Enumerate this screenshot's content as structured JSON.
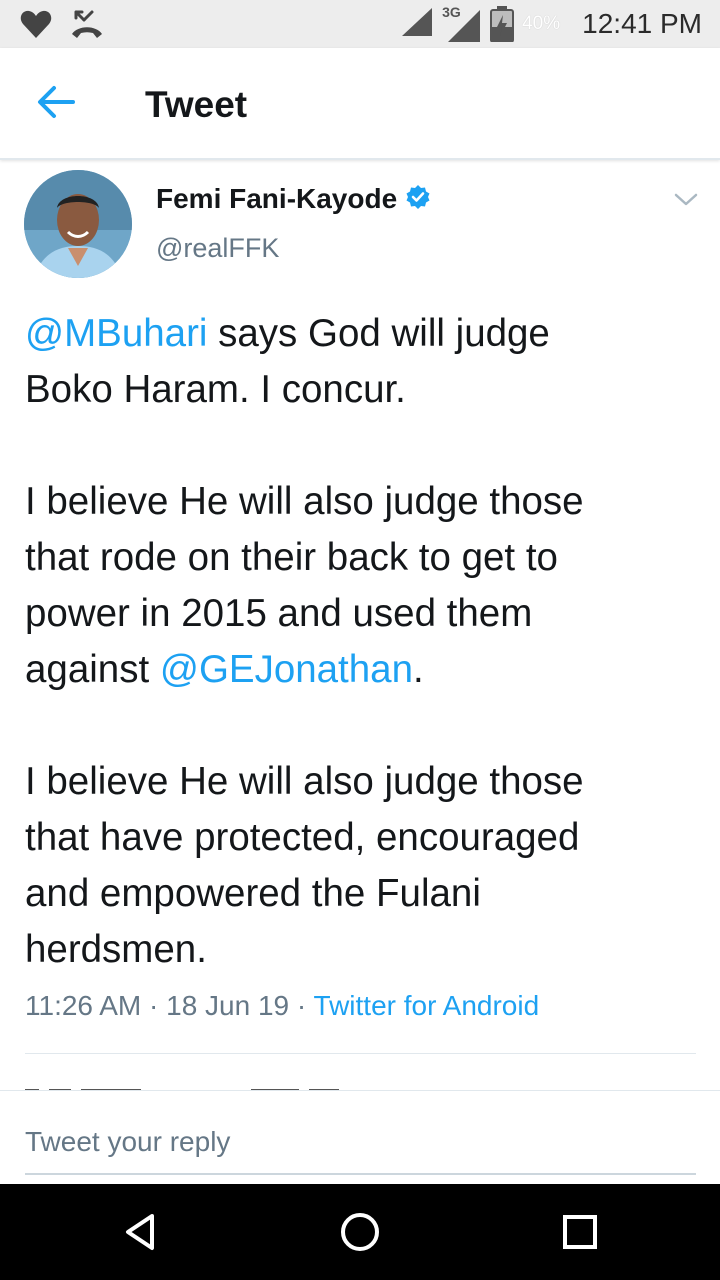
{
  "status_bar": {
    "network_type": "3G",
    "battery_percent": "40%",
    "time": "12:41 PM",
    "icons": [
      "heart-icon",
      "missed-call-icon",
      "signal-icon",
      "signal-3g-icon",
      "battery-icon"
    ]
  },
  "header": {
    "back_icon": "arrow-left-icon",
    "title": "Tweet"
  },
  "tweet": {
    "author": {
      "name": "Femi Fani-Kayode",
      "verified": true,
      "handle": "@realFFK",
      "avatar": "avatar-photo"
    },
    "paragraphs": [
      {
        "line1_mention": "@MBuhari",
        "line1_text": " says God will judge",
        "line2": "Boko Haram. I concur."
      },
      {
        "line1": "I believe He will also judge those",
        "line2": "that rode on their back to get to",
        "line3": "power in 2015 and used them",
        "line4_text": "against ",
        "line4_mention": "@GEJonathan",
        "line4_end": "."
      },
      {
        "line1": "I believe He will also judge those",
        "line2": "that have protected, encouraged",
        "line3": "and empowered the Fulani",
        "line4": "herdsmen."
      }
    ],
    "time": "11:26 AM",
    "separator": " · ",
    "date": "18 Jun 19",
    "source": "Twitter for Android"
  },
  "reply": {
    "placeholder": "Tweet your reply",
    "value": ""
  },
  "nav_bar": {
    "icons": [
      "back-triangle-icon",
      "home-circle-icon",
      "recents-square-icon"
    ]
  },
  "colors": {
    "accent": "#1da1f2",
    "text_primary": "#14171a",
    "text_secondary": "#657786",
    "status_bar_bg": "#ededed",
    "nav_bar_bg": "#000000"
  }
}
